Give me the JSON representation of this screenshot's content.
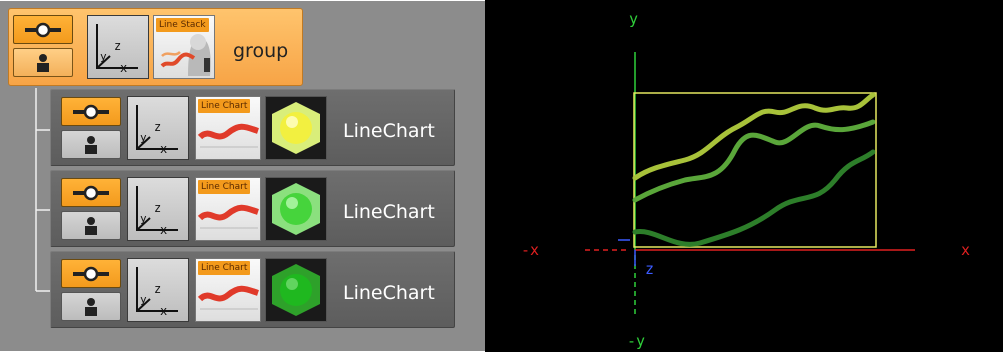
{
  "tree": {
    "group": {
      "label": "group",
      "thumb_label": "Line Stack",
      "icons": {
        "visibility": "eye-icon",
        "lock": "lock-icon",
        "transform": "axis-icon"
      }
    },
    "children": [
      {
        "label": "LineChart",
        "thumb_label": "Line Chart",
        "material_color": "#f2f040"
      },
      {
        "label": "LineChart",
        "thumb_label": "Line Chart",
        "material_color": "#46d43c"
      },
      {
        "label": "LineChart",
        "thumb_label": "Line Chart",
        "material_color": "#1fb81f"
      }
    ]
  },
  "viewport": {
    "axes": {
      "y_pos": "y",
      "y_neg": "-y",
      "x_pos": "x",
      "x_neg": "-x",
      "z": "z",
      "colors": {
        "y": "#2fcf3a",
        "x": "#e02020",
        "z": "#3b5bff"
      }
    },
    "series_colors": [
      "#a8c23a",
      "#5aa63a",
      "#2d7e2a"
    ],
    "frame_color": "#e6e860"
  }
}
